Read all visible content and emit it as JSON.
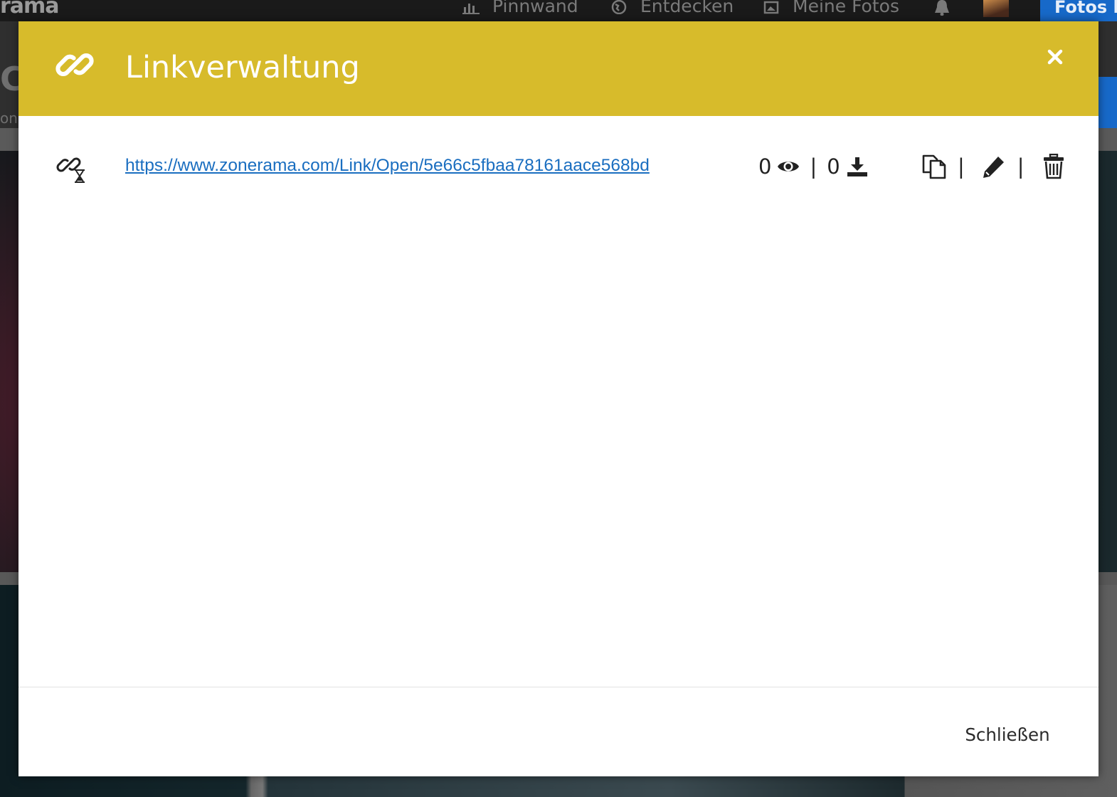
{
  "background": {
    "logo_text": "rama",
    "nav": [
      {
        "label": "Pinnwand",
        "icon": "chart-icon"
      },
      {
        "label": "Entdecken",
        "icon": "globe-icon"
      },
      {
        "label": "Meine Fotos",
        "icon": "photos-icon"
      }
    ],
    "upload_label": "Fotos h",
    "sub_title_fragment": "Co",
    "sub_text_fragment": "on"
  },
  "modal": {
    "title": "Linkverwaltung",
    "header_icon": "link-icon",
    "close_icon": "close-icon",
    "links": [
      {
        "url": "https://www.zonerama.com/Link/Open/5e66c5fbaa78161aace568bd",
        "status_icon": "link-timed-icon",
        "views": "0",
        "downloads": "0",
        "stat_separator": "|",
        "action_separator": "|"
      }
    ],
    "footer": {
      "close_label": "Schließen"
    }
  },
  "colors": {
    "header": "#d7bb2b",
    "link": "#1a6ec0",
    "upload_button": "#1769c9"
  }
}
